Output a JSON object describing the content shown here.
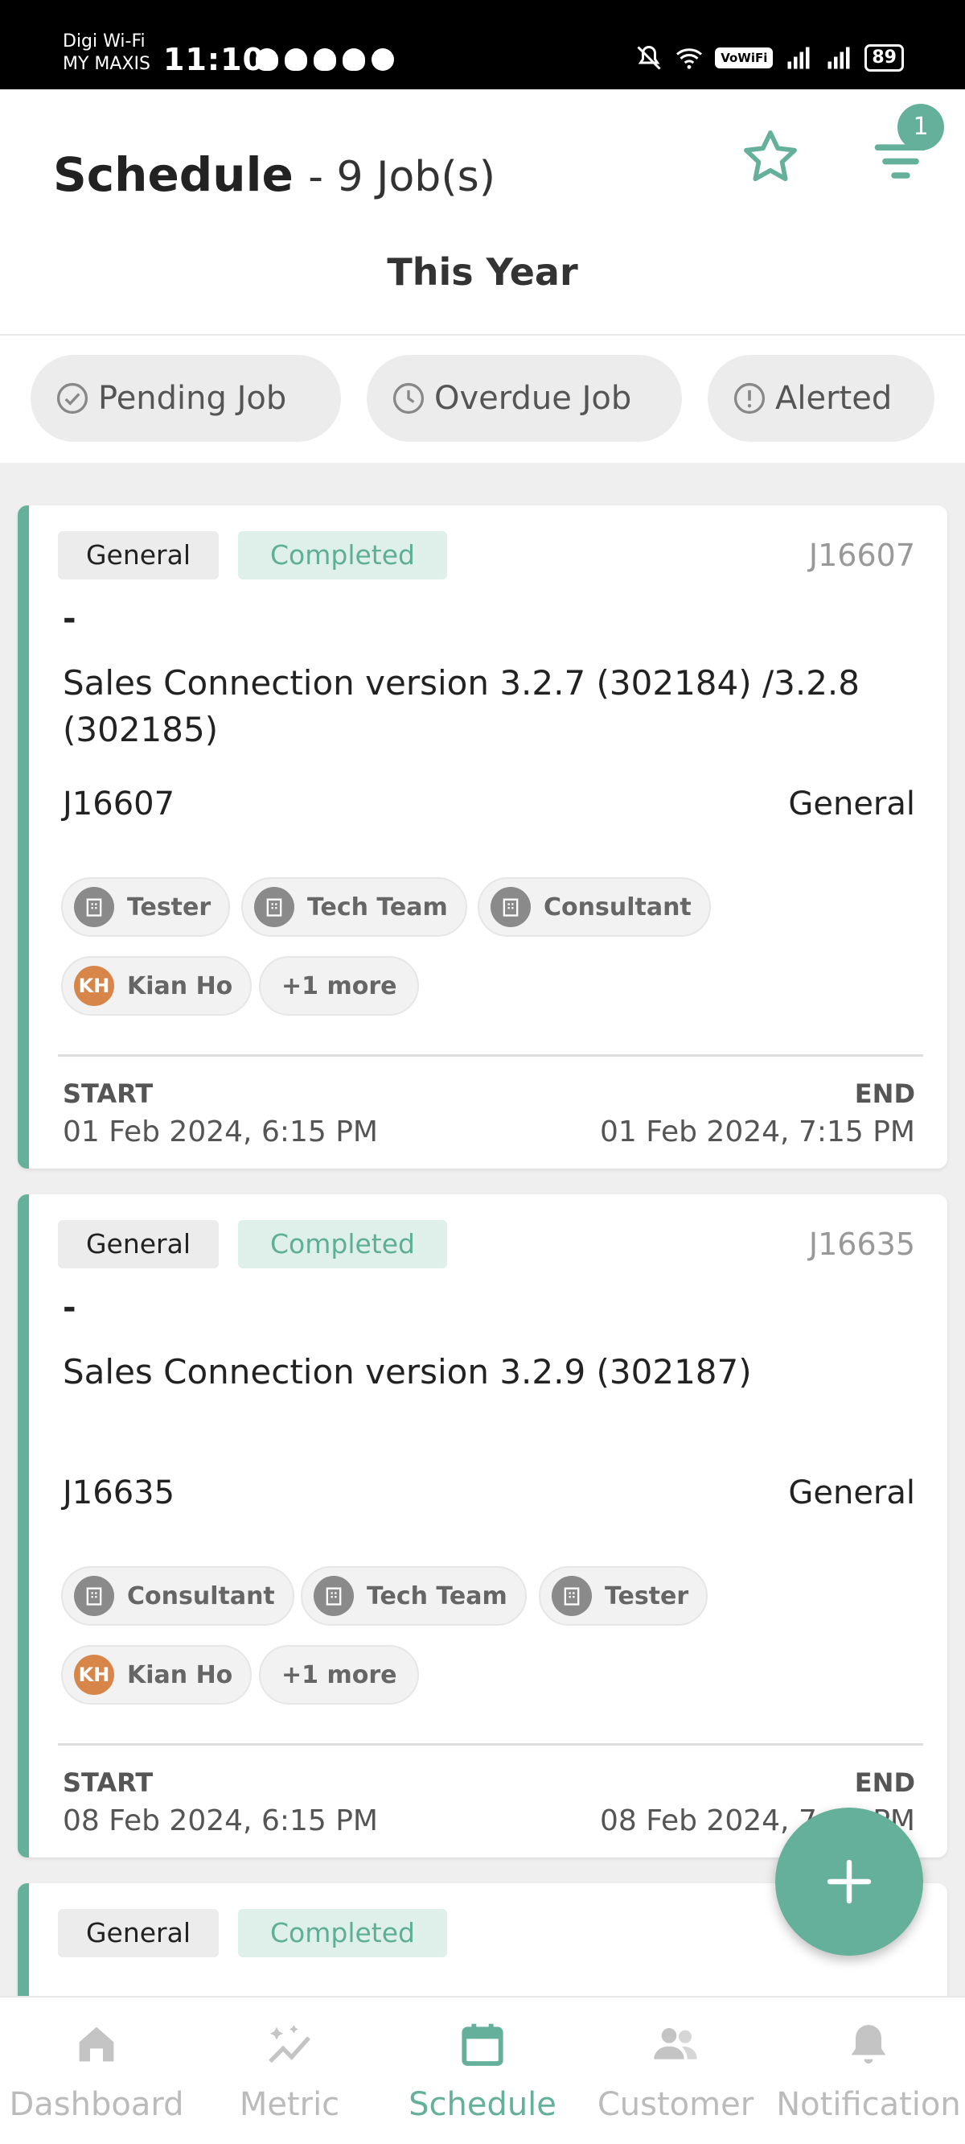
{
  "status_bar": {
    "carrier_line1": "Digi Wi-Fi",
    "carrier_line2": "MY MAXIS",
    "time": "11:10",
    "vowifi": "VoWiFi",
    "battery": "89"
  },
  "header": {
    "title": "Schedule",
    "job_count": "- 9 Job(s)",
    "filter_badge": "1",
    "period": "This Year"
  },
  "chips": [
    {
      "label": "Pending Job",
      "icon": "check-circle-icon"
    },
    {
      "label": "Overdue Job",
      "icon": "clock-icon"
    },
    {
      "label": "Alerted",
      "icon": "alert-circle-icon"
    }
  ],
  "jobs": [
    {
      "category": "General",
      "status": "Completed",
      "job_id": "J16607",
      "dash": "-",
      "description": "Sales Connection version 3.2.7 (302184) /3.2.8 (302185)",
      "code": "J16607",
      "type": "General",
      "teams": [
        "Tester",
        "Tech Team",
        "Consultant"
      ],
      "assignee_initials": "KH",
      "assignee": "Kian Ho",
      "more": "+1 more",
      "start_label": "START",
      "start": "01 Feb 2024, 6:15 PM",
      "end_label": "END",
      "end": "01 Feb 2024, 7:15 PM"
    },
    {
      "category": "General",
      "status": "Completed",
      "job_id": "J16635",
      "dash": "-",
      "description": "Sales Connection version 3.2.9 (302187)",
      "code": "J16635",
      "type": "General",
      "teams": [
        "Consultant",
        "Tech Team",
        "Tester"
      ],
      "assignee_initials": "KH",
      "assignee": "Kian Ho",
      "more": "+1 more",
      "start_label": "START",
      "start": "08 Feb 2024, 6:15 PM",
      "end_label": "END",
      "end": "08 Feb 2024, 7:15 PM"
    },
    {
      "category": "General",
      "status": "Completed"
    }
  ],
  "bottom_nav": [
    {
      "label": "Dashboard",
      "icon": "home-icon"
    },
    {
      "label": "Metric",
      "icon": "sparkle-chart-icon"
    },
    {
      "label": "Schedule",
      "icon": "calendar-icon",
      "active": true
    },
    {
      "label": "Customer",
      "icon": "users-icon"
    },
    {
      "label": "Notification",
      "icon": "bell-icon"
    }
  ],
  "colors": {
    "accent": "#64b09a",
    "completed_bg": "#dff0ea",
    "avatar": "#d8854a"
  }
}
